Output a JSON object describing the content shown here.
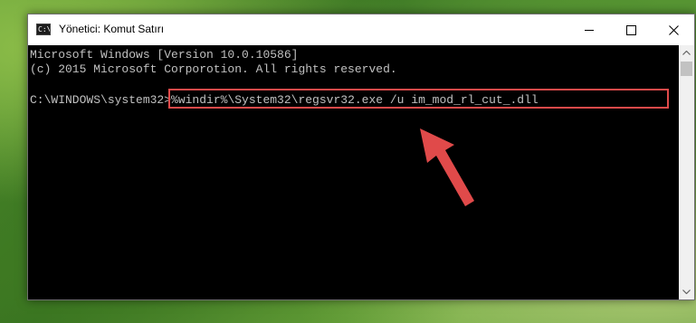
{
  "window": {
    "title": "Yönetici: Komut Satırı",
    "icon": "C:\\"
  },
  "console": {
    "line1": "Microsoft Windows [Version 10.0.10586]",
    "line2": "(c) 2015 Microsoft Corporotion. All rights reserved.",
    "prompt": "C:\\WINDOWS\\system32>",
    "command": "%windir%\\System32\\regsvr32.exe /u im_mod_rl_cut_.dll"
  },
  "colors": {
    "highlight": "#e04a4a",
    "arrow": "#e04a4a",
    "console_bg": "#000000",
    "console_text": "#c0c0c0"
  },
  "icons": [
    "cmd-app-icon",
    "minimize-icon",
    "maximize-icon",
    "close-icon",
    "scroll-up-arrow-icon",
    "scroll-down-arrow-icon",
    "red-arrow-annotation-icon"
  ]
}
